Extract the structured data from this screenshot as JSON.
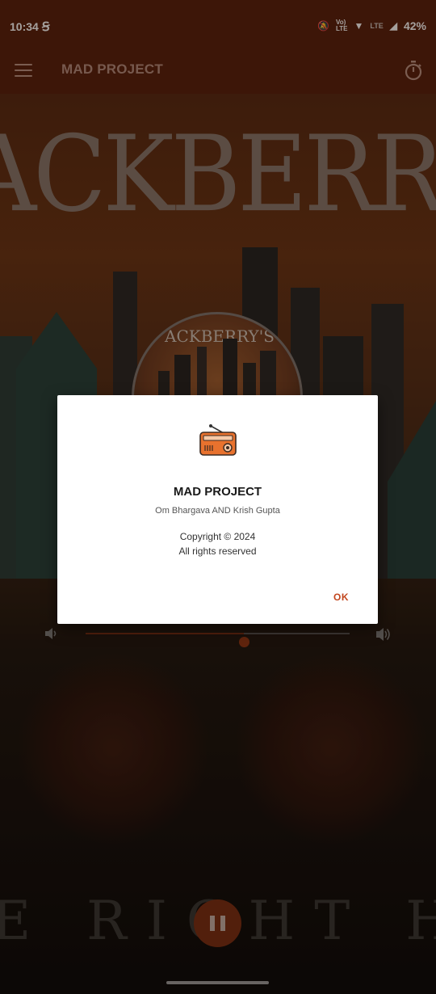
{
  "status_bar": {
    "time": "10:34",
    "network": "LTE",
    "battery": "42%"
  },
  "app_bar": {
    "title": "MAD PROJECT",
    "menu_icon": "hamburger-menu-icon",
    "timer_icon": "stopwatch-icon"
  },
  "artwork": {
    "title_text": "ACKBERRY'S SM",
    "bottom_text": "E RIGHT HER"
  },
  "player": {
    "volume_level": 0.6,
    "state_icon": "pause-icon"
  },
  "dialog": {
    "icon": "radio-icon",
    "title": "MAD PROJECT",
    "authors": "Om Bhargava AND Krish Gupta",
    "copyright": "Copyright © 2024",
    "rights": "All rights reserved",
    "ok_label": "OK"
  },
  "colors": {
    "app_bar": "#5a210c",
    "accent": "#c2461e",
    "radio_orange": "#e8722e"
  }
}
